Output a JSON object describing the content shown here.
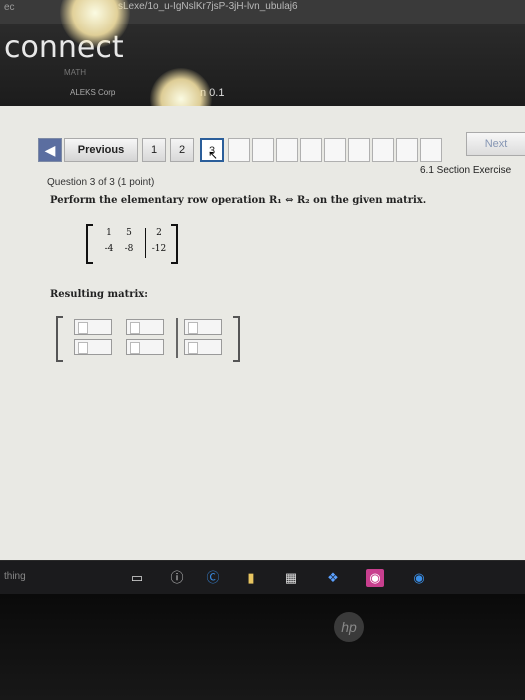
{
  "browser": {
    "url_fragment": "sLexe/1o_u-IgNslKr7jsP-3jH-lvn_ubulaj6",
    "left_fragment": "ec"
  },
  "app": {
    "logo": "connect",
    "sublogo": "MATH",
    "header_line1": "ALEKS Corp",
    "header_line2": "n 0.1"
  },
  "nav": {
    "previous_label": "Previous",
    "next_label": "Next",
    "questions": [
      "1",
      "2",
      "3"
    ],
    "current_question": 3
  },
  "question": {
    "section": "6.1 Section Exercise",
    "number_text": "Question 3 of 3 (1 point)",
    "prompt": "Perform the elementary row operation R₁ ⇔ R₂ on the given matrix.",
    "matrix": {
      "row1": [
        "1",
        "5",
        "2"
      ],
      "row2": [
        "-4",
        "-8",
        "-12"
      ]
    },
    "resulting_label": "Resulting matrix:"
  },
  "taskbar": {
    "search_text": "thing"
  },
  "colors": {
    "accent": "#5b6ea0",
    "current_question_border": "#2b5e9a",
    "page_background": "#e9e9e4"
  }
}
